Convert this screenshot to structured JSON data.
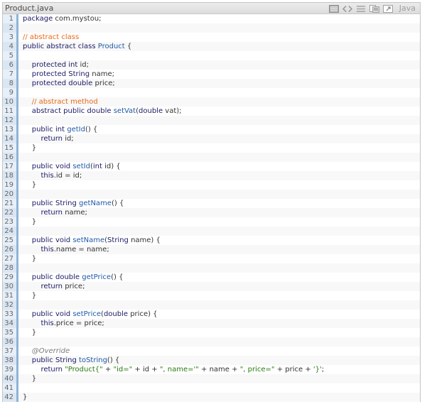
{
  "window": {
    "filename": "Product.java",
    "language": "Java",
    "toolbar": [
      {
        "name": "toggle-view-icon"
      },
      {
        "name": "view-source-icon"
      },
      {
        "name": "toggle-line-numbers-icon"
      },
      {
        "name": "copy-icon"
      },
      {
        "name": "open-in-window-icon"
      }
    ]
  },
  "colors": {
    "keyword": "#1a1a66",
    "comment": "#e96a16",
    "function": "#1e5aa8",
    "string": "#2a7a12",
    "annotation": "#7b7b7b",
    "gutter_bar": "#8fb4d8"
  },
  "lines": [
    {
      "n": "1",
      "tokens": [
        [
          "kw",
          "package"
        ],
        [
          "tx",
          " com.mystou;"
        ]
      ]
    },
    {
      "n": "2",
      "tokens": []
    },
    {
      "n": "3",
      "tokens": [
        [
          "cm",
          "// abstract class"
        ]
      ]
    },
    {
      "n": "4",
      "tokens": [
        [
          "kw",
          "public abstract class"
        ],
        [
          "tx",
          " "
        ],
        [
          "fn",
          "Product"
        ],
        [
          "tx",
          " {"
        ]
      ]
    },
    {
      "n": "5",
      "tokens": []
    },
    {
      "n": "6",
      "tokens": [
        [
          "tx",
          "    "
        ],
        [
          "kw",
          "protected int"
        ],
        [
          "tx",
          " id;"
        ]
      ]
    },
    {
      "n": "7",
      "tokens": [
        [
          "tx",
          "    "
        ],
        [
          "kw",
          "protected String"
        ],
        [
          "tx",
          " name;"
        ]
      ]
    },
    {
      "n": "8",
      "tokens": [
        [
          "tx",
          "    "
        ],
        [
          "kw",
          "protected double"
        ],
        [
          "tx",
          " price;"
        ]
      ]
    },
    {
      "n": "9",
      "tokens": []
    },
    {
      "n": "10",
      "tokens": [
        [
          "tx",
          "    "
        ],
        [
          "cm",
          "// abstract method"
        ]
      ]
    },
    {
      "n": "11",
      "tokens": [
        [
          "tx",
          "    "
        ],
        [
          "kw",
          "abstract public double"
        ],
        [
          "tx",
          " "
        ],
        [
          "fn",
          "setVat"
        ],
        [
          "tx",
          "("
        ],
        [
          "kw",
          "double"
        ],
        [
          "tx",
          " vat);"
        ]
      ]
    },
    {
      "n": "12",
      "tokens": []
    },
    {
      "n": "13",
      "tokens": [
        [
          "tx",
          "    "
        ],
        [
          "kw",
          "public int"
        ],
        [
          "tx",
          " "
        ],
        [
          "fn",
          "getId"
        ],
        [
          "tx",
          "() {"
        ]
      ]
    },
    {
      "n": "14",
      "tokens": [
        [
          "tx",
          "        "
        ],
        [
          "kw",
          "return"
        ],
        [
          "tx",
          " id;"
        ]
      ]
    },
    {
      "n": "15",
      "tokens": [
        [
          "tx",
          "    }"
        ]
      ]
    },
    {
      "n": "16",
      "tokens": []
    },
    {
      "n": "17",
      "tokens": [
        [
          "tx",
          "    "
        ],
        [
          "kw",
          "public void"
        ],
        [
          "tx",
          " "
        ],
        [
          "fn",
          "setId"
        ],
        [
          "tx",
          "("
        ],
        [
          "kw",
          "int"
        ],
        [
          "tx",
          " id) {"
        ]
      ]
    },
    {
      "n": "18",
      "tokens": [
        [
          "tx",
          "        "
        ],
        [
          "kw",
          "this"
        ],
        [
          "tx",
          ".id = id;"
        ]
      ]
    },
    {
      "n": "19",
      "tokens": [
        [
          "tx",
          "    }"
        ]
      ]
    },
    {
      "n": "20",
      "tokens": []
    },
    {
      "n": "21",
      "tokens": [
        [
          "tx",
          "    "
        ],
        [
          "kw",
          "public String"
        ],
        [
          "tx",
          " "
        ],
        [
          "fn",
          "getName"
        ],
        [
          "tx",
          "() {"
        ]
      ]
    },
    {
      "n": "22",
      "tokens": [
        [
          "tx",
          "        "
        ],
        [
          "kw",
          "return"
        ],
        [
          "tx",
          " name;"
        ]
      ]
    },
    {
      "n": "23",
      "tokens": [
        [
          "tx",
          "    }"
        ]
      ]
    },
    {
      "n": "24",
      "tokens": []
    },
    {
      "n": "25",
      "tokens": [
        [
          "tx",
          "    "
        ],
        [
          "kw",
          "public void"
        ],
        [
          "tx",
          " "
        ],
        [
          "fn",
          "setName"
        ],
        [
          "tx",
          "("
        ],
        [
          "kw",
          "String"
        ],
        [
          "tx",
          " name) {"
        ]
      ]
    },
    {
      "n": "26",
      "tokens": [
        [
          "tx",
          "        "
        ],
        [
          "kw",
          "this"
        ],
        [
          "tx",
          ".name = name;"
        ]
      ]
    },
    {
      "n": "27",
      "tokens": [
        [
          "tx",
          "    }"
        ]
      ]
    },
    {
      "n": "28",
      "tokens": []
    },
    {
      "n": "29",
      "tokens": [
        [
          "tx",
          "    "
        ],
        [
          "kw",
          "public double"
        ],
        [
          "tx",
          " "
        ],
        [
          "fn",
          "getPrice"
        ],
        [
          "tx",
          "() {"
        ]
      ]
    },
    {
      "n": "30",
      "tokens": [
        [
          "tx",
          "        "
        ],
        [
          "kw",
          "return"
        ],
        [
          "tx",
          " price;"
        ]
      ]
    },
    {
      "n": "31",
      "tokens": [
        [
          "tx",
          "    }"
        ]
      ]
    },
    {
      "n": "32",
      "tokens": []
    },
    {
      "n": "33",
      "tokens": [
        [
          "tx",
          "    "
        ],
        [
          "kw",
          "public void"
        ],
        [
          "tx",
          " "
        ],
        [
          "fn",
          "setPrice"
        ],
        [
          "tx",
          "("
        ],
        [
          "kw",
          "double"
        ],
        [
          "tx",
          " price) {"
        ]
      ]
    },
    {
      "n": "34",
      "tokens": [
        [
          "tx",
          "        "
        ],
        [
          "kw",
          "this"
        ],
        [
          "tx",
          ".price = price;"
        ]
      ]
    },
    {
      "n": "35",
      "tokens": [
        [
          "tx",
          "    }"
        ]
      ]
    },
    {
      "n": "36",
      "tokens": []
    },
    {
      "n": "37",
      "tokens": [
        [
          "tx",
          "    "
        ],
        [
          "an",
          "@Override"
        ]
      ]
    },
    {
      "n": "38",
      "tokens": [
        [
          "tx",
          "    "
        ],
        [
          "kw",
          "public String"
        ],
        [
          "tx",
          " "
        ],
        [
          "fn",
          "toString"
        ],
        [
          "tx",
          "() {"
        ]
      ]
    },
    {
      "n": "39",
      "tokens": [
        [
          "tx",
          "        "
        ],
        [
          "kw",
          "return"
        ],
        [
          "tx",
          " "
        ],
        [
          "st",
          "\"Product{\""
        ],
        [
          "tx",
          " + "
        ],
        [
          "st",
          "\"id=\""
        ],
        [
          "tx",
          " + id + "
        ],
        [
          "st",
          "\", name='\""
        ],
        [
          "tx",
          " + name + "
        ],
        [
          "st",
          "\", price=\""
        ],
        [
          "tx",
          " + price + "
        ],
        [
          "st",
          "'}'"
        ],
        [
          "tx",
          ";"
        ]
      ]
    },
    {
      "n": "40",
      "tokens": [
        [
          "tx",
          "    }"
        ]
      ]
    },
    {
      "n": "41",
      "tokens": []
    },
    {
      "n": "42",
      "tokens": [
        [
          "tx",
          "}"
        ]
      ]
    }
  ]
}
